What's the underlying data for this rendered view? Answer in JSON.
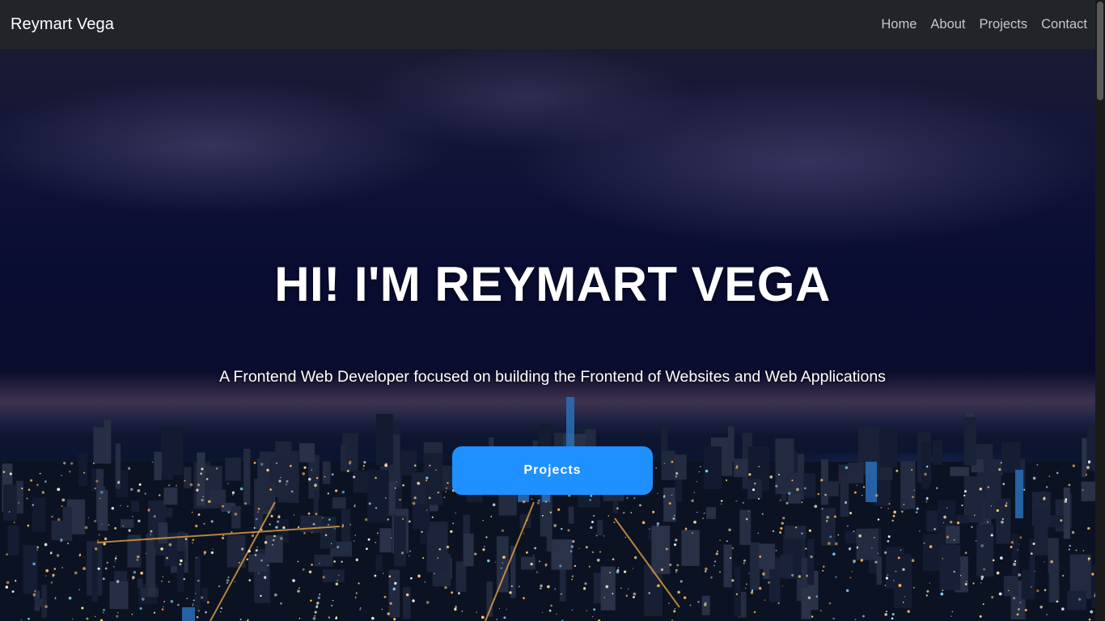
{
  "navbar": {
    "brand": "Reymart Vega",
    "links": [
      {
        "label": "Home"
      },
      {
        "label": "About"
      },
      {
        "label": "Projects"
      },
      {
        "label": "Contact"
      }
    ]
  },
  "hero": {
    "headline": "HI! I'M REYMART VEGA",
    "subtitle": "A Frontend Web Developer focused on building the Frontend of Websites and Web Applications",
    "cta_label": "Projects",
    "background": "night-city-skyline-image"
  },
  "colors": {
    "navbar_bg": "#212529",
    "accent": "#1e90ff",
    "text": "#ffffff",
    "nav_link": "#c4c6c9"
  }
}
